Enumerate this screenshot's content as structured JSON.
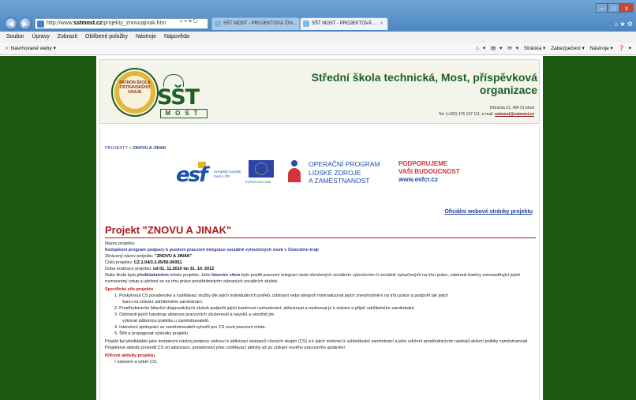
{
  "browser": {
    "url_prefix": "http://www.",
    "url_domain": "sstmost.cz",
    "url_path": "/projekty_znovuajinak.htm",
    "addr_tools": "⌕ ▾ ≡ ↻",
    "tabs": [
      {
        "label": "SŠT MOST - PROJEKTOVÁ ČIN..."
      },
      {
        "label": "SŠT MOST - PROJEKTOVÁ ...",
        "close": "×"
      }
    ],
    "window_controls": {
      "min": "–",
      "max": "□",
      "close": "x"
    },
    "right_icons": "⌂ ★ ⚙"
  },
  "menu": [
    "Soubor",
    "Úpravy",
    "Zobrazit",
    "Oblíbené položky",
    "Nástroje",
    "Nápověda"
  ],
  "favbar": {
    "suggested": "Navrhované weby ▾",
    "tools": [
      "▾",
      "▾",
      "▾",
      "Stránka ▾",
      "Zabezpečení ▾",
      "Nástroje ▾",
      "▾"
    ]
  },
  "header": {
    "badge_text": "PATRON ŠKOLA OSTRAVSKÉHO KRAJE",
    "logo_big": "SŠT",
    "logo_most": "MOST",
    "school_name": "Střední škola technická, Most, příspěvková organizace",
    "address": "Dělnická 21, 434 01 Most",
    "phone_prefix": "Tel: (+420) 476 137 111, e-mail: ",
    "email": "sstmost@sstmost.cz"
  },
  "breadcrumb": {
    "parent": "PROJEKTY",
    "sep": " > ",
    "current": "ZNOVU A JINAK"
  },
  "logos": {
    "esf": "esf",
    "esf_caption": "evropský sociální fond v ČR",
    "eu_caption": "EVROPSKÁ UNIE",
    "op": [
      "OPERAČNÍ PROGRAM",
      "LIDSKÉ ZDROJE",
      "A ZAMĚSTNANOST"
    ],
    "podp": [
      "PODPORUJEME",
      "VAŠI BUDOUCNOST"
    ],
    "url": "www.esfcr.cz"
  },
  "official_link": "Oficiální webové stránky projektu",
  "project": {
    "title": "Projekt \"ZNOVU A JINAK\"",
    "name_label": "Název projektu:",
    "name_value": "Komplexní program podpory k posílení pracovní integrace sociálně vyloučených osob v Ústeckém kraji",
    "short_label": "Zkrácený název projektu: ",
    "short_value": "\"ZNOVU A JINAK\"",
    "number_label": "Číslo projektu: ",
    "number_value": "CZ.1.04/3.3.05/56.00051",
    "duration_label": "Doba realizace projektu: ",
    "duration_value": "od 01. 11.2010 do 31. 10. 2012",
    "intro_1": "Naše škola byla ",
    "intro_bold1": "předkladatelem",
    "intro_2": " tohoto projektu. Jeho ",
    "intro_bold2": "hlavním cílem",
    "intro_3": " bylo posílit pracovní integraci osob ohrožených sociálním vyloučením či sociálně vyloučených na trhu práce, odstranit bariéry znesnadňující jejich rovnocenný vstup a udržení se na trhu práce prostřednictvím vybraných sociálních služeb.",
    "specific_heading": "Specifické cíle projektu",
    "specific_items": [
      "1.   Poskytnout CS poradenské a vzdělávací služby dle jejich individuálních potřeb, odstranit nebo alespoň minimalizovat jejich znevýhodnění na trhu práce a podpořit tak jejich",
      "šanci na získání udržitelného zaměstnání.",
      "2.   Prostřednictvím bilanční diagnostických služeb podpořit jejich kariérové rozhodování, aktivizovat a motivovat je k získání a přijetí udržitelného zaměstnání.",
      "3.   Odstranit jejich handicap absence pracovních zkušeností a návyků a umožnit jim",
      "vykonat odbornou praktiku u zaměstnavatelů.",
      "4.   Intenzivní spolupráci se zaměstnavateli vytvořit pro CS nová pracovní místa.",
      "5.   Šířit a propagovat výsledky projektu"
    ],
    "closing": "Projekt byl předkládán jako komplexní nástroj podpory vedoucí k aktivizaci zástupců cílových skupin (CS) a k jejich motivaci k vyhledávání zaměstnání a jeho udržení prostřednictvím nástrojů aktivní politiky zaměstnanosti. Projektové aktivity provedli CS od aktivizace, poradenství přes vzdělávací aktivity až po získání nového pracovního uplatnění.",
    "key_heading": "Klíčové aktivity projektu",
    "key_items": [
      "• oslovení a výběr CS;"
    ]
  }
}
